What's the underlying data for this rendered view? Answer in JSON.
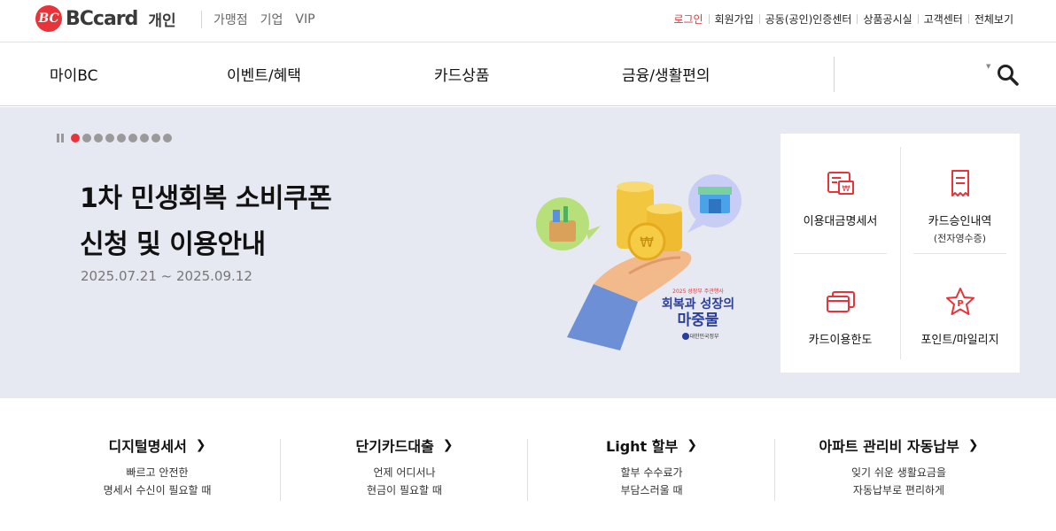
{
  "header": {
    "brand": "BCcard",
    "brand_sub": "개인",
    "segments": [
      "가맹점",
      "기업",
      "VIP"
    ],
    "util_links": [
      "로그인",
      "회원가입",
      "공동(공인)인증센터",
      "상품공시실",
      "고객센터",
      "전체보기"
    ]
  },
  "gnb": {
    "items": [
      "마이BC",
      "이벤트/혜택",
      "카드상품",
      "금융/생활편의"
    ]
  },
  "hero": {
    "title_line1": "1차 민생회복 소비쿠폰",
    "title_line2": "신청 및 이용안내",
    "date": "2025.07.21 ~ 2025.09.12",
    "slide_total": 9,
    "slide_active": 1,
    "art_badge_small": "2025 성장부 주관행사",
    "art_badge_main1": "회복과 성장의",
    "art_badge_main2": "마중물",
    "art_gov": "대한민국정부"
  },
  "quick_menu": [
    {
      "label": "이용대금명세서",
      "sub": "",
      "icon": "statement-icon"
    },
    {
      "label": "카드승인내역",
      "sub": "(전자영수증)",
      "icon": "receipt-icon"
    },
    {
      "label": "카드이용한도",
      "sub": "",
      "icon": "card-limit-icon"
    },
    {
      "label": "포인트/마일리지",
      "sub": "",
      "icon": "point-icon"
    }
  ],
  "services": [
    {
      "title": "디지털명세서",
      "desc1": "빠르고 안전한",
      "desc2": "명세서 수신이 필요할 때"
    },
    {
      "title": "단기카드대출",
      "desc1": "언제 어디서나",
      "desc2": "현금이 필요할 때"
    },
    {
      "title": "Light 할부",
      "desc1": "할부 수수료가",
      "desc2": "부담스러울 때"
    },
    {
      "title": "아파트 관리비 자동납부",
      "desc1": "잊기 쉬운 생활요금을",
      "desc2": "자동납부로 편리하게"
    }
  ],
  "colors": {
    "accent": "#e8333a",
    "hero_bg": "#e6e9f1"
  }
}
